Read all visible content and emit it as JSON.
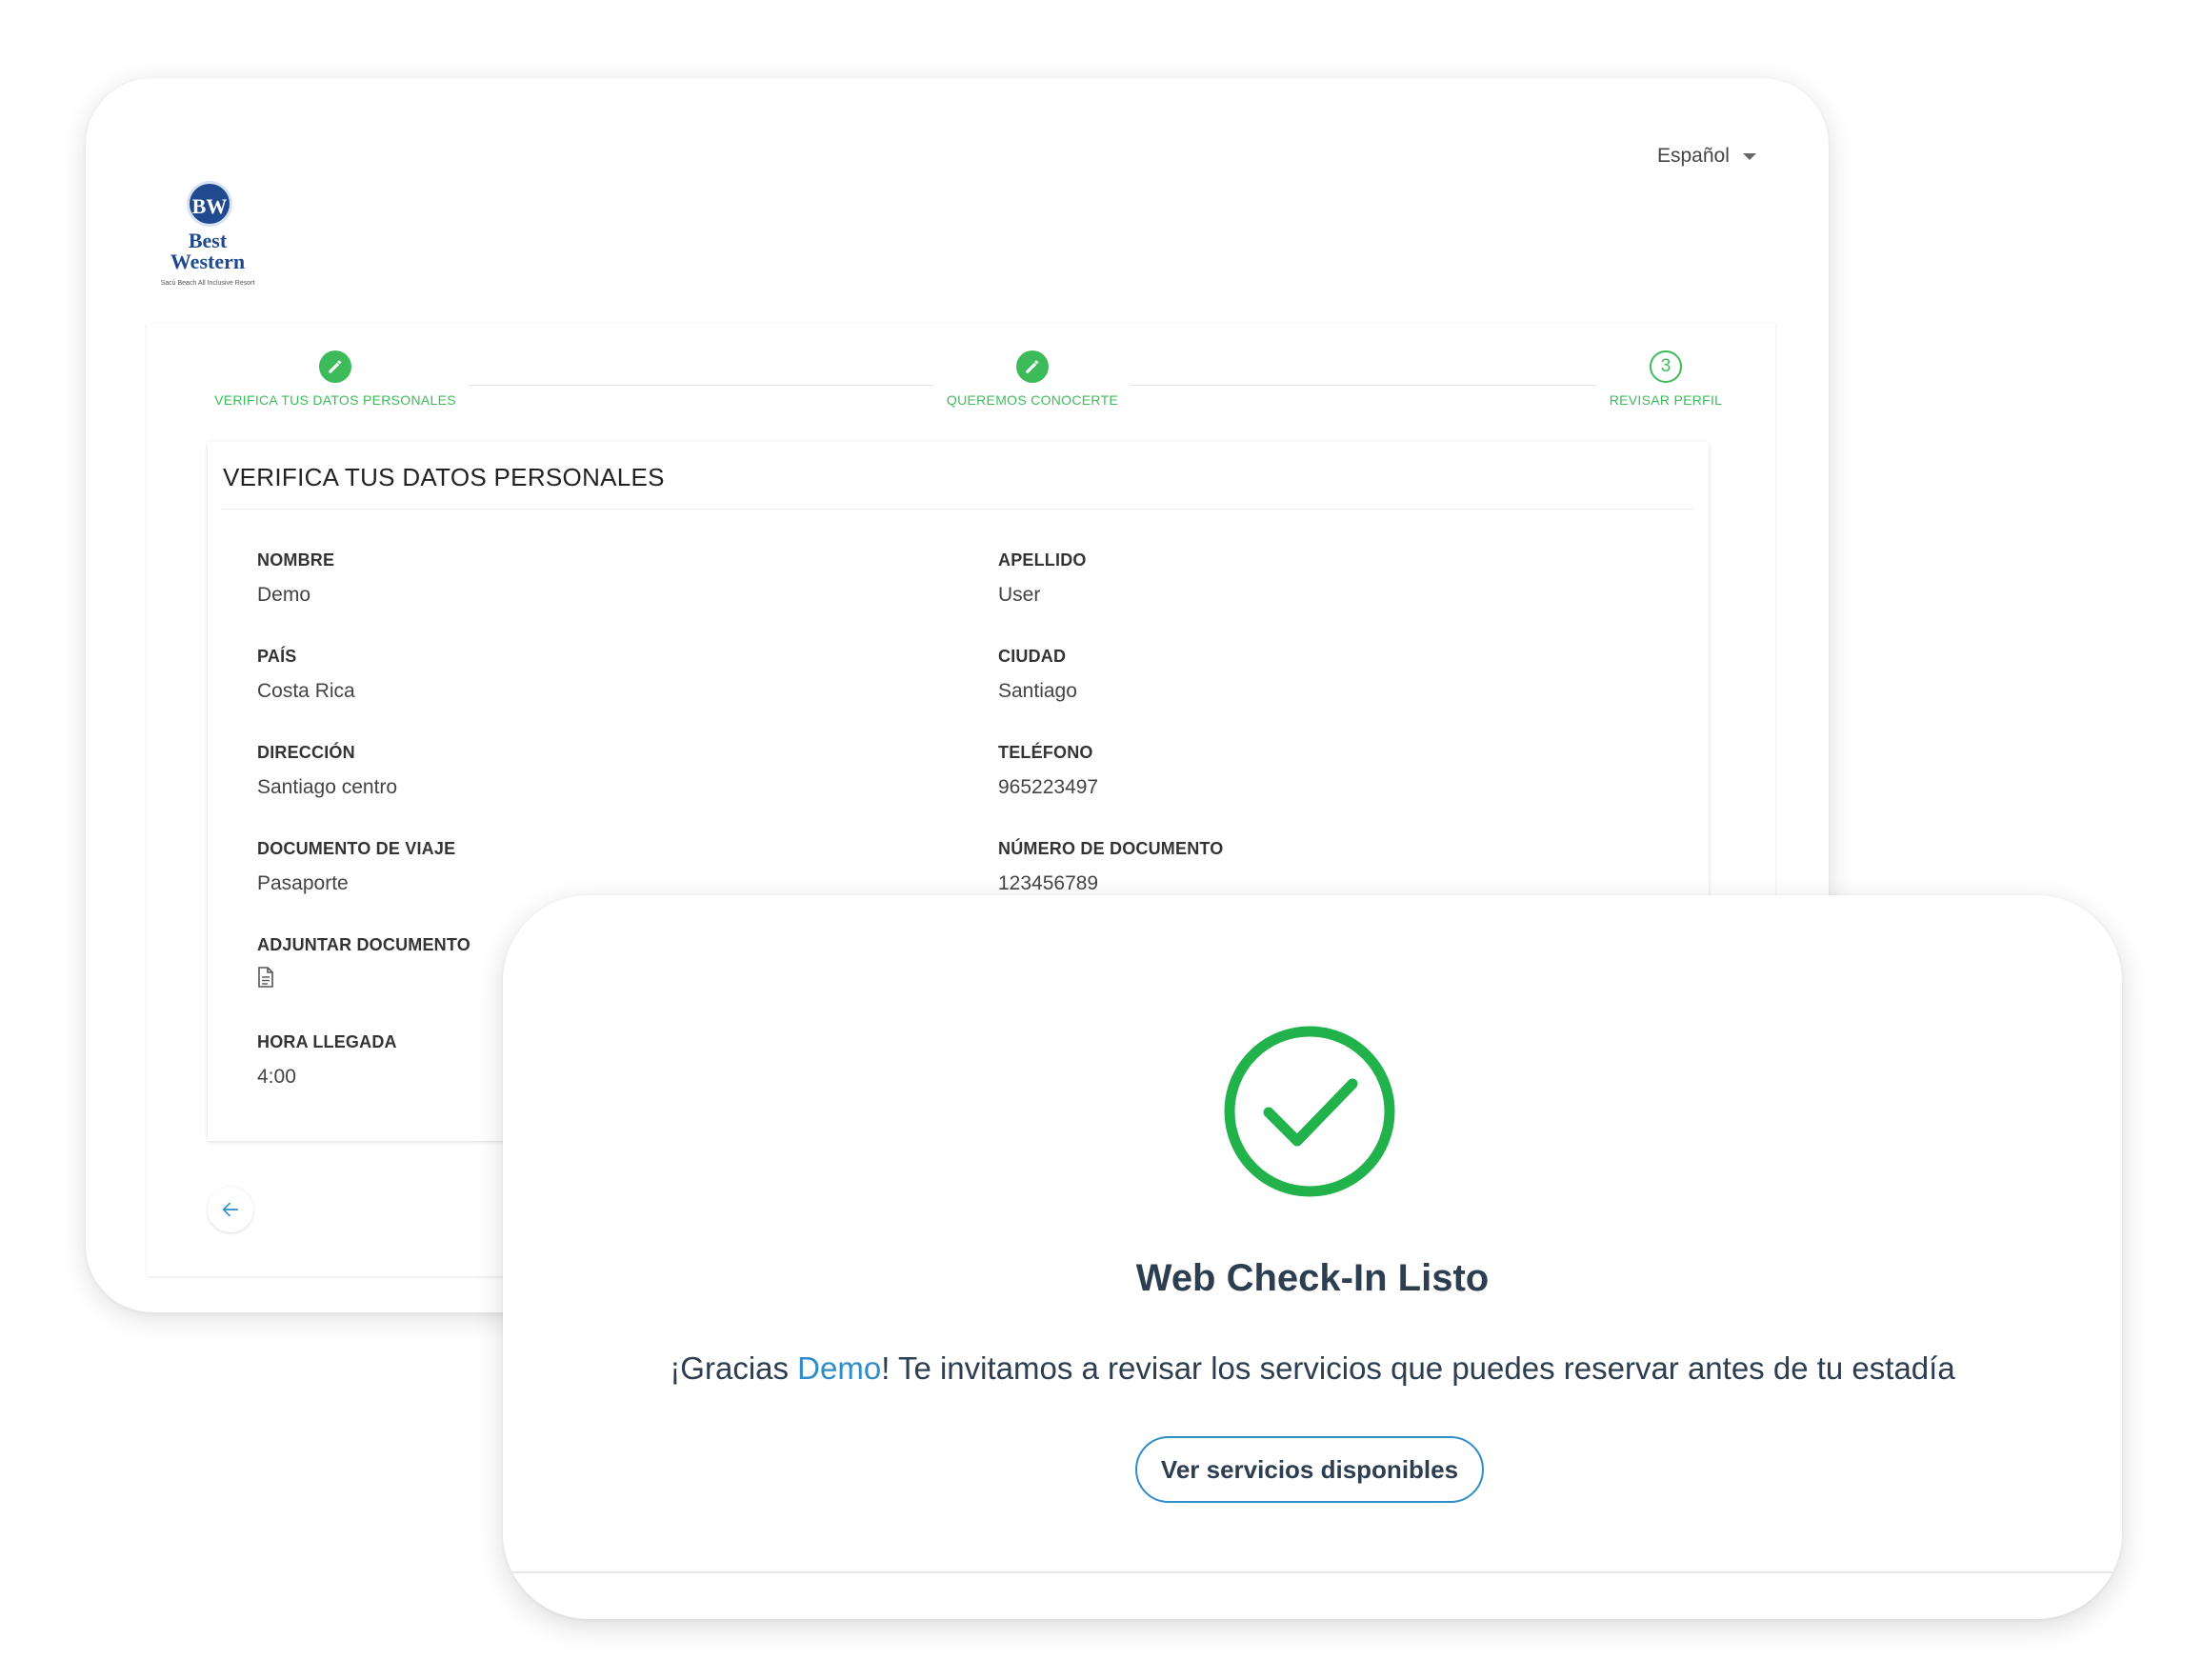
{
  "header": {
    "language": "Español",
    "logo": {
      "badge": "BW",
      "line1": "Best",
      "line2": "Western",
      "subtitle": "Sacú Beach All Inclusive Resort"
    }
  },
  "stepper": {
    "steps": [
      {
        "label": "VERIFICA TUS DATOS PERSONALES",
        "state": "done",
        "icon": "pencil-icon"
      },
      {
        "label": "QUEREMOS CONOCERTE",
        "state": "done",
        "icon": "pencil-icon"
      },
      {
        "label": "REVISAR PERFIL",
        "state": "current",
        "number": "3"
      }
    ],
    "color": "#3dbb5a"
  },
  "form": {
    "title": "VERIFICA TUS DATOS PERSONALES",
    "fields": [
      {
        "label": "NOMBRE",
        "value": "Demo"
      },
      {
        "label": "APELLIDO",
        "value": "User"
      },
      {
        "label": "PAÍS",
        "value": "Costa Rica"
      },
      {
        "label": "CIUDAD",
        "value": "Santiago"
      },
      {
        "label": "DIRECCIÓN",
        "value": "Santiago centro"
      },
      {
        "label": "TELÉFONO",
        "value": "965223497"
      },
      {
        "label": "DOCUMENTO DE VIAJE",
        "value": "Pasaporte"
      },
      {
        "label": "NÚMERO DE DOCUMENTO",
        "value": "123456789"
      },
      {
        "label": "ADJUNTAR DOCUMENTO",
        "icon": "document-icon"
      },
      {
        "label": "HORA LLEGADA",
        "value": "4:00"
      }
    ]
  },
  "nav": {
    "back_icon": "arrow-left-icon"
  },
  "success": {
    "icon": "check-circle-icon",
    "title": "Web Check-In Listo",
    "message_prefix": "¡Gracias ",
    "guest_name": "Demo",
    "message_suffix": "! Te invitamos a revisar los servicios que puedes reservar antes de tu estadía",
    "button_label": "Ver servicios disponibles",
    "accent": "#2f8dc8",
    "check_color": "#22b24c"
  }
}
